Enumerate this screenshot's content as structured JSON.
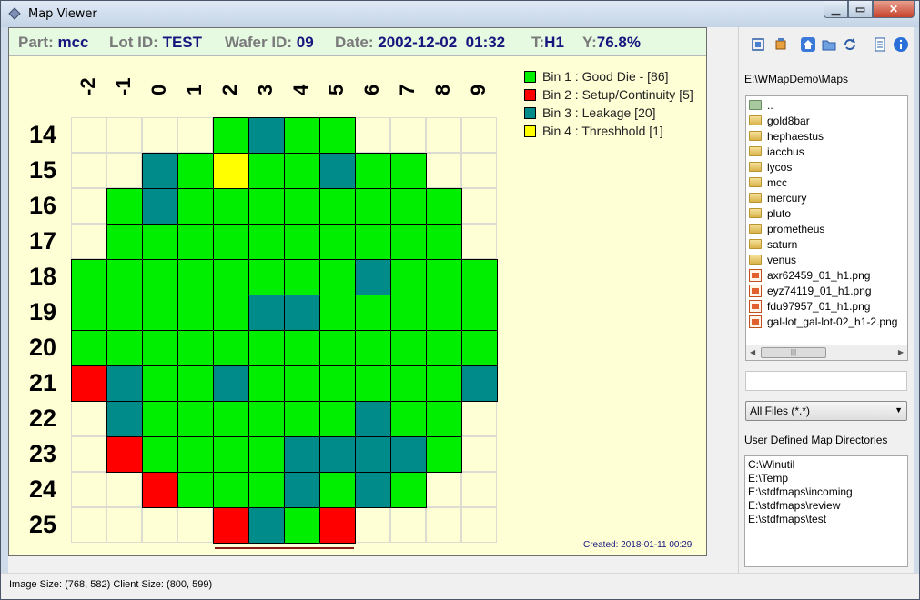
{
  "window": {
    "title": "Map Viewer"
  },
  "header": {
    "part_label": "Part:",
    "part": "mcc",
    "lot_label": "Lot ID:",
    "lot": "TEST",
    "wafer_label": "Wafer ID:",
    "wafer": "09",
    "date_label": "Date:",
    "date": "2002-12-02  01:32",
    "test_label": "T:",
    "test": "H1",
    "yield_label": "Y:",
    "yield": "76.8%"
  },
  "wafer_map": {
    "columns": [
      "-2",
      "-1",
      "0",
      "1",
      "2",
      "3",
      "4",
      "5",
      "6",
      "7",
      "8",
      "9"
    ],
    "rows": [
      "14",
      "15",
      "16",
      "17",
      "18",
      "19",
      "20",
      "21",
      "22",
      "23",
      "24",
      "25"
    ],
    "bin_colors": {
      "1": "#00ee00",
      "2": "#ff0000",
      "3": "#008b8b",
      "4": "#ffff00"
    },
    "dies": [
      "....1311....",
      "..31411311..",
      ".1311111111.",
      ".1111111111.",
      "111111113111",
      "111113311111",
      "111111111111",
      "231131111113",
      ".3111111311.",
      ".2111133331.",
      "..21113131..",
      "....2312...."
    ],
    "created": "Created: 2018-01-11 00:29"
  },
  "legend": [
    {
      "label": "Bin 1 : Good Die - [86]",
      "color": "#00ee00"
    },
    {
      "label": "Bin 2 : Setup/Continuity [5]",
      "color": "#ff0000"
    },
    {
      "label": "Bin 3 : Leakage [20]",
      "color": "#008b8b"
    },
    {
      "label": "Bin 4 : Threshhold [1]",
      "color": "#ffff00"
    }
  ],
  "sidebar": {
    "path": "E:\\WMapDemo\\Maps",
    "files": [
      {
        "name": "..",
        "type": "parent"
      },
      {
        "name": "gold8bar",
        "type": "folder"
      },
      {
        "name": "hephaestus",
        "type": "folder"
      },
      {
        "name": "iacchus",
        "type": "folder"
      },
      {
        "name": "lycos",
        "type": "folder"
      },
      {
        "name": "mcc",
        "type": "folder"
      },
      {
        "name": "mercury",
        "type": "folder"
      },
      {
        "name": "pluto",
        "type": "folder"
      },
      {
        "name": "prometheus",
        "type": "folder"
      },
      {
        "name": "saturn",
        "type": "folder"
      },
      {
        "name": "venus",
        "type": "folder"
      },
      {
        "name": "axr62459_01_h1.png",
        "type": "png"
      },
      {
        "name": "eyz74119_01_h1.png",
        "type": "png"
      },
      {
        "name": "fdu97957_01_h1.png",
        "type": "png"
      },
      {
        "name": "gal-lot_gal-lot-02_h1-2.png",
        "type": "png"
      }
    ],
    "filter_value": "",
    "file_type": "All Files (*.*)",
    "user_dirs_label": "User Defined Map Directories",
    "user_dirs": [
      "C:\\Winutil",
      "E:\\Temp",
      "E:\\stdfmaps\\incoming",
      "E:\\stdfmaps\\review",
      "E:\\stdfmaps\\test"
    ]
  },
  "status": {
    "text": "Image Size: (768, 582)  Client Size: (800, 599)"
  }
}
